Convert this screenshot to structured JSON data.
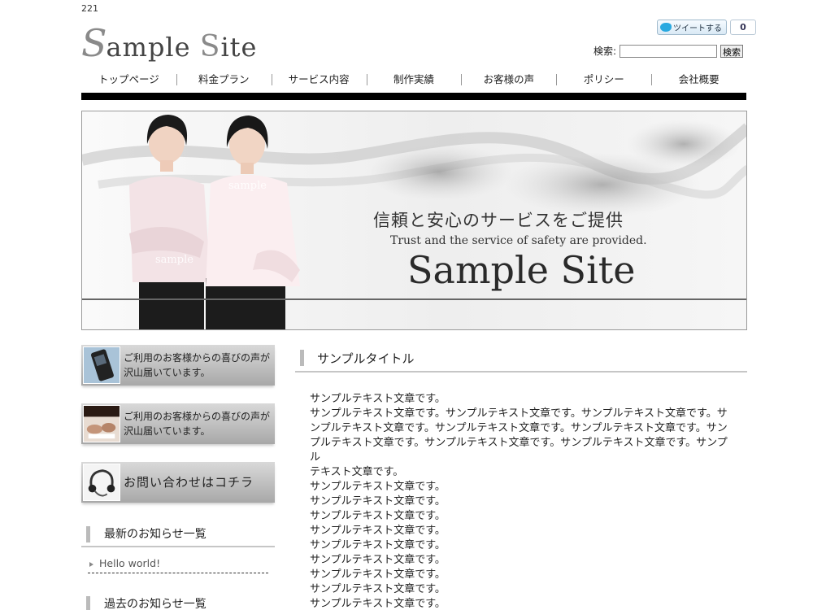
{
  "page_id": "221",
  "logo": {
    "first_big": "S",
    "rest1": "ample ",
    "second_big": "S",
    "rest2": "ite"
  },
  "tweet": {
    "label": "ツイートする",
    "count": "0"
  },
  "search": {
    "label": "検索:",
    "value": "",
    "button": "検索"
  },
  "nav": [
    "トップページ",
    "料金プラン",
    "サービス内容",
    "制作実績",
    "お客様の声",
    "ポリシー",
    "会社概要"
  ],
  "hero": {
    "jp": "信頼と安心のサービスをご提供",
    "en": "Trust and the service of safety are provided.",
    "title": "Sample Site",
    "watermark": "sample"
  },
  "sidebar": {
    "banners": [
      {
        "line1": "ご利用のお客様からの喜びの声が",
        "line2": "沢山届いています。"
      },
      {
        "line1": "ご利用のお客様からの喜びの声が",
        "line2": "沢山届いています。"
      },
      {
        "line1": "お問い合わせはコチラ",
        "line2": ""
      }
    ],
    "latest_heading": "最新のお知らせ一覧",
    "latest_items": [
      "Hello world!"
    ],
    "past_heading": "過去のお知らせ一覧"
  },
  "main": {
    "title": "サンプルタイトル",
    "lines": [
      "サンプルテキスト文章です。",
      "サンプルテキスト文章です。サンプルテキスト文章です。サンプルテキスト文章です。サ",
      "ンプルテキスト文章です。サンプルテキスト文章です。サンプルテキスト文章です。サン",
      "プルテキスト文章です。サンプルテキスト文章です。サンプルテキスト文章です。サンプル",
      "テキスト文章です。",
      "サンプルテキスト文章です。",
      "サンプルテキスト文章です。",
      "サンプルテキスト文章です。",
      "サンプルテキスト文章です。",
      "サンプルテキスト文章です。",
      "サンプルテキスト文章です。",
      "サンプルテキスト文章です。",
      "サンプルテキスト文章です。",
      "サンプルテキスト文章です。"
    ]
  },
  "colors": {
    "nav_bar": "#000000",
    "banner_gray": "#a8a8a8",
    "heading_accent": "#bbbbbb"
  }
}
